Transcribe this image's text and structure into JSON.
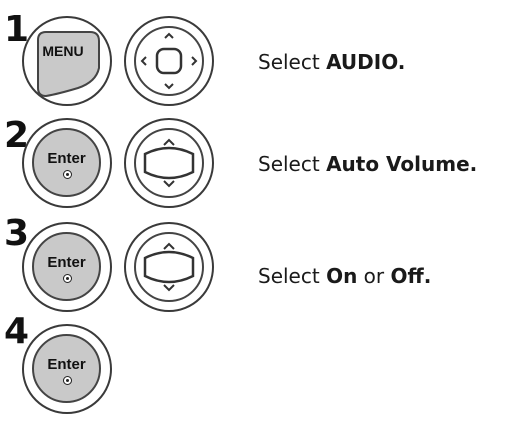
{
  "steps": [
    {
      "number": "1",
      "button": "MENU",
      "caption_prefix": "Select ",
      "caption_bold": "AUDIO.",
      "nav_icon": "four-way-nav-icon"
    },
    {
      "number": "2",
      "button": "Enter",
      "caption_prefix": "Select ",
      "caption_bold": "Auto Volume.",
      "nav_icon": "up-down-nav-icon"
    },
    {
      "number": "3",
      "button": "Enter",
      "caption_prefix": "Select ",
      "caption_bold": "On",
      "caption_mid": " or ",
      "caption_bold2": "Off.",
      "nav_icon": "up-down-nav-icon"
    },
    {
      "number": "4",
      "button": "Enter"
    }
  ]
}
